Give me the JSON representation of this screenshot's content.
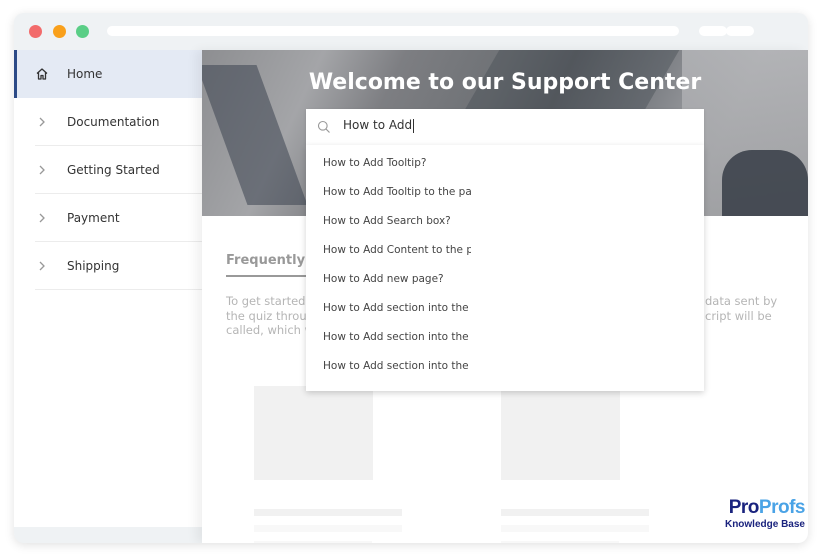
{
  "window": {
    "controls": [
      "close",
      "minimize",
      "maximize"
    ]
  },
  "sidebar": {
    "items": [
      {
        "label": "Home",
        "icon": "home-icon",
        "active": true
      },
      {
        "label": "Documentation",
        "icon": "chevron-right-icon",
        "active": false
      },
      {
        "label": "Getting Started",
        "icon": "chevron-right-icon",
        "active": false
      },
      {
        "label": "Payment",
        "icon": "chevron-right-icon",
        "active": false
      },
      {
        "label": "Shipping",
        "icon": "chevron-right-icon",
        "active": false
      }
    ]
  },
  "hero": {
    "title": "Welcome to our Support Center"
  },
  "search": {
    "value": "How to Add",
    "icon": "search-icon",
    "suggestions": [
      "How to Add Tooltip?",
      "How to Add Tooltip to the page",
      "How to Add Search box?",
      "How to Add Content to the page",
      "How to Add new page?",
      "How to Add section into the page",
      "How to Add section into the page",
      "How to Add section into the page"
    ]
  },
  "faq": {
    "title": "Frequently Asked Questions",
    "text_left_lines": [
      "To get started,",
      "the quiz throug",
      "called, which w"
    ],
    "text_right_lines": [
      "data sent by",
      "cript will be"
    ]
  },
  "branding": {
    "brand_part1": "Pro",
    "brand_part2": "Profs",
    "subtitle": "Knowledge Base",
    "colors": {
      "primary": "#1a237e",
      "secondary": "#4aa3e6"
    }
  },
  "theme": {
    "active_nav_bg": "#e4eaf4",
    "active_nav_border": "#2c4a86"
  }
}
